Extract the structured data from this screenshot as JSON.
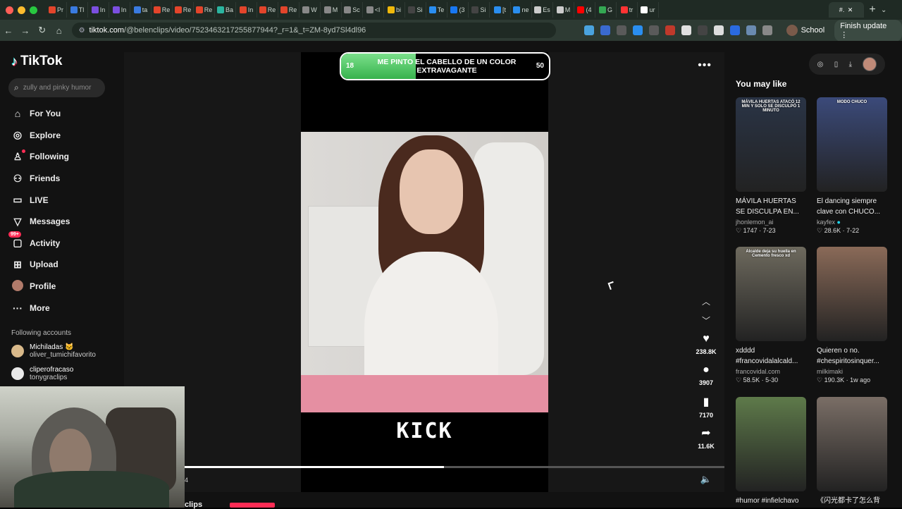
{
  "browser": {
    "tabs": [
      {
        "label": "Pr",
        "color": "#e3452b"
      },
      {
        "label": "Tl",
        "color": "#3a7be0"
      },
      {
        "label": "In",
        "color": "#7b4fe0"
      },
      {
        "label": "In",
        "color": "#7b4fe0"
      },
      {
        "label": "ta",
        "color": "#3a7be0"
      },
      {
        "label": "Re",
        "color": "#e3452b"
      },
      {
        "label": "Re",
        "color": "#e3452b"
      },
      {
        "label": "Re",
        "color": "#e3452b"
      },
      {
        "label": "Ba",
        "color": "#2bb5a0"
      },
      {
        "label": "In",
        "color": "#e3452b"
      },
      {
        "label": "Re",
        "color": "#e3452b"
      },
      {
        "label": "Re",
        "color": "#e3452b"
      },
      {
        "label": "W",
        "color": "#888888"
      },
      {
        "label": "M",
        "color": "#888888"
      },
      {
        "label": "Sc",
        "color": "#888888"
      },
      {
        "label": "<l",
        "color": "#888888"
      },
      {
        "label": "bi",
        "color": "#f0b90b"
      },
      {
        "label": "Si",
        "color": "#444444"
      },
      {
        "label": "Te",
        "color": "#2a8ef0"
      },
      {
        "label": "(3",
        "color": "#1877f2"
      },
      {
        "label": "Si",
        "color": "#444444"
      },
      {
        "label": "[t",
        "color": "#2a8ef0"
      },
      {
        "label": "ne",
        "color": "#2a8ef0"
      },
      {
        "label": "Es",
        "color": "#cccccc"
      },
      {
        "label": "M",
        "color": "#cccccc"
      },
      {
        "label": "(4",
        "color": "#ff0000"
      },
      {
        "label": "G",
        "color": "#34a853"
      },
      {
        "label": "tr",
        "color": "#ff3333"
      },
      {
        "label": "ur",
        "color": "#ffffff"
      }
    ],
    "active_tab": "#.",
    "url_host": "tiktok.com",
    "url_path": "/@belenclips/video/7523463217255877944?_r=1&_t=ZM-8yd7Sl4dl96",
    "profile_label": "School",
    "finish_update_label": "Finish update"
  },
  "sidebar": {
    "logo_text": "TikTok",
    "search_placeholder": "zully and pinky humor",
    "nav": [
      {
        "label": "For You",
        "icon": "home-icon",
        "glyph": "⌂"
      },
      {
        "label": "Explore",
        "icon": "compass-icon",
        "glyph": "◎"
      },
      {
        "label": "Following",
        "icon": "following-icon",
        "glyph": "♙"
      },
      {
        "label": "Friends",
        "icon": "friends-icon",
        "glyph": "⚇"
      },
      {
        "label": "LIVE",
        "icon": "live-icon",
        "glyph": "▭"
      },
      {
        "label": "Messages",
        "icon": "messages-icon",
        "glyph": "▽"
      },
      {
        "label": "Activity",
        "icon": "activity-icon",
        "glyph": "▢",
        "badge": "99+"
      },
      {
        "label": "Upload",
        "icon": "upload-icon",
        "glyph": "⊞"
      },
      {
        "label": "Profile",
        "icon": "profile-avatar",
        "glyph": ""
      },
      {
        "label": "More",
        "icon": "more-icon",
        "glyph": "···"
      }
    ],
    "following_heading": "Following accounts",
    "accounts": [
      {
        "display": "Michiladas 🐱",
        "username": "oliver_tumichifavorito",
        "color": "#d9b98a"
      },
      {
        "display": "cliperofracaso",
        "username": "tonygraclips",
        "color": "#e8e8e8"
      }
    ]
  },
  "video": {
    "poll": {
      "left": "18",
      "right": "50",
      "question": "ME PINTO EL CABELLO DE UN COLOR EXTRAVAGANTE",
      "progress": 0.36
    },
    "overlay_text": "KICK",
    "likes": "238.8K",
    "comments": "3907",
    "saves": "7170",
    "shares": "11.6K",
    "progress": 0.48,
    "time": "4",
    "clip_label": "clips"
  },
  "right": {
    "heading": "You may like",
    "cards": [
      {
        "title": "MÁVILA HUERTAS SE DISCULPA EN...",
        "author": "jhonlemon_ai",
        "likes": "1747",
        "date": "7-23",
        "caption": "MÁVILA HUERTAS ATACÓ 12 MIN Y SOLO SE DISCULPÓ 1 MINUTO",
        "bg": "#2a3446"
      },
      {
        "title": "El dancing siempre clave con CHUCO...",
        "author": "kayfex",
        "likes": "28.6K",
        "date": "7-22",
        "caption": "MODO CHUCO",
        "bg": "#3b4a7a",
        "verified": true
      },
      {
        "title": "xdddd #francovidalalcald...",
        "author": "francovidal.com",
        "likes": "58.5K",
        "date": "5-30",
        "caption": "Alcalde deja su huella en Cemento fresco xd",
        "bg": "#6e6a5e"
      },
      {
        "title": "Quieren o no. #chespiritosinquer...",
        "author": "milkimaki",
        "likes": "190.3K",
        "date": "1w ago",
        "caption": "",
        "bg": "#8a6a58"
      },
      {
        "title": "#humor #infielchavo",
        "author": "",
        "likes": "",
        "date": "",
        "caption": "",
        "bg": "#5e7a4a"
      },
      {
        "title": "《闪光都卡了怎么背",
        "author": "",
        "likes": "",
        "date": "",
        "caption": "",
        "bg": "#7a6e66"
      }
    ]
  }
}
